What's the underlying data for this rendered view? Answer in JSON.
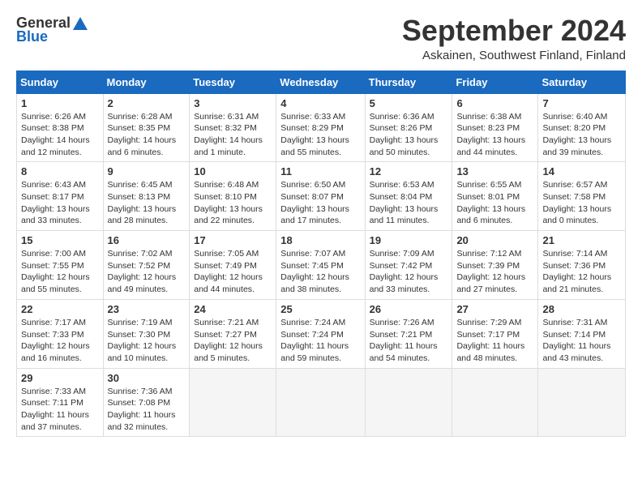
{
  "header": {
    "logo_general": "General",
    "logo_blue": "Blue",
    "month_title": "September 2024",
    "location": "Askainen, Southwest Finland, Finland"
  },
  "days_of_week": [
    "Sunday",
    "Monday",
    "Tuesday",
    "Wednesday",
    "Thursday",
    "Friday",
    "Saturday"
  ],
  "weeks": [
    [
      {
        "day": "1",
        "sunrise": "6:26 AM",
        "sunset": "8:38 PM",
        "daylight": "14 hours and 12 minutes."
      },
      {
        "day": "2",
        "sunrise": "6:28 AM",
        "sunset": "8:35 PM",
        "daylight": "14 hours and 6 minutes."
      },
      {
        "day": "3",
        "sunrise": "6:31 AM",
        "sunset": "8:32 PM",
        "daylight": "14 hours and 1 minute."
      },
      {
        "day": "4",
        "sunrise": "6:33 AM",
        "sunset": "8:29 PM",
        "daylight": "13 hours and 55 minutes."
      },
      {
        "day": "5",
        "sunrise": "6:36 AM",
        "sunset": "8:26 PM",
        "daylight": "13 hours and 50 minutes."
      },
      {
        "day": "6",
        "sunrise": "6:38 AM",
        "sunset": "8:23 PM",
        "daylight": "13 hours and 44 minutes."
      },
      {
        "day": "7",
        "sunrise": "6:40 AM",
        "sunset": "8:20 PM",
        "daylight": "13 hours and 39 minutes."
      }
    ],
    [
      {
        "day": "8",
        "sunrise": "6:43 AM",
        "sunset": "8:17 PM",
        "daylight": "13 hours and 33 minutes."
      },
      {
        "day": "9",
        "sunrise": "6:45 AM",
        "sunset": "8:13 PM",
        "daylight": "13 hours and 28 minutes."
      },
      {
        "day": "10",
        "sunrise": "6:48 AM",
        "sunset": "8:10 PM",
        "daylight": "13 hours and 22 minutes."
      },
      {
        "day": "11",
        "sunrise": "6:50 AM",
        "sunset": "8:07 PM",
        "daylight": "13 hours and 17 minutes."
      },
      {
        "day": "12",
        "sunrise": "6:53 AM",
        "sunset": "8:04 PM",
        "daylight": "13 hours and 11 minutes."
      },
      {
        "day": "13",
        "sunrise": "6:55 AM",
        "sunset": "8:01 PM",
        "daylight": "13 hours and 6 minutes."
      },
      {
        "day": "14",
        "sunrise": "6:57 AM",
        "sunset": "7:58 PM",
        "daylight": "13 hours and 0 minutes."
      }
    ],
    [
      {
        "day": "15",
        "sunrise": "7:00 AM",
        "sunset": "7:55 PM",
        "daylight": "12 hours and 55 minutes."
      },
      {
        "day": "16",
        "sunrise": "7:02 AM",
        "sunset": "7:52 PM",
        "daylight": "12 hours and 49 minutes."
      },
      {
        "day": "17",
        "sunrise": "7:05 AM",
        "sunset": "7:49 PM",
        "daylight": "12 hours and 44 minutes."
      },
      {
        "day": "18",
        "sunrise": "7:07 AM",
        "sunset": "7:45 PM",
        "daylight": "12 hours and 38 minutes."
      },
      {
        "day": "19",
        "sunrise": "7:09 AM",
        "sunset": "7:42 PM",
        "daylight": "12 hours and 33 minutes."
      },
      {
        "day": "20",
        "sunrise": "7:12 AM",
        "sunset": "7:39 PM",
        "daylight": "12 hours and 27 minutes."
      },
      {
        "day": "21",
        "sunrise": "7:14 AM",
        "sunset": "7:36 PM",
        "daylight": "12 hours and 21 minutes."
      }
    ],
    [
      {
        "day": "22",
        "sunrise": "7:17 AM",
        "sunset": "7:33 PM",
        "daylight": "12 hours and 16 minutes."
      },
      {
        "day": "23",
        "sunrise": "7:19 AM",
        "sunset": "7:30 PM",
        "daylight": "12 hours and 10 minutes."
      },
      {
        "day": "24",
        "sunrise": "7:21 AM",
        "sunset": "7:27 PM",
        "daylight": "12 hours and 5 minutes."
      },
      {
        "day": "25",
        "sunrise": "7:24 AM",
        "sunset": "7:24 PM",
        "daylight": "11 hours and 59 minutes."
      },
      {
        "day": "26",
        "sunrise": "7:26 AM",
        "sunset": "7:21 PM",
        "daylight": "11 hours and 54 minutes."
      },
      {
        "day": "27",
        "sunrise": "7:29 AM",
        "sunset": "7:17 PM",
        "daylight": "11 hours and 48 minutes."
      },
      {
        "day": "28",
        "sunrise": "7:31 AM",
        "sunset": "7:14 PM",
        "daylight": "11 hours and 43 minutes."
      }
    ],
    [
      {
        "day": "29",
        "sunrise": "7:33 AM",
        "sunset": "7:11 PM",
        "daylight": "11 hours and 37 minutes."
      },
      {
        "day": "30",
        "sunrise": "7:36 AM",
        "sunset": "7:08 PM",
        "daylight": "11 hours and 32 minutes."
      },
      null,
      null,
      null,
      null,
      null
    ]
  ],
  "labels": {
    "sunrise_prefix": "Sunrise: ",
    "sunset_prefix": "Sunset: ",
    "daylight_prefix": "Daylight: "
  }
}
